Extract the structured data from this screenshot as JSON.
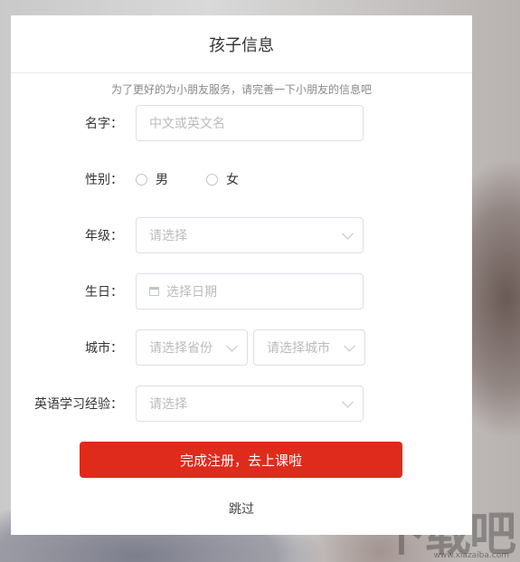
{
  "modal": {
    "title": "孩子信息",
    "hint": "为了更好的为小朋友服务，请完善一下小朋友的信息吧"
  },
  "form": {
    "name": {
      "label": "名字：",
      "placeholder": "中文或英文名"
    },
    "gender": {
      "label": "性别：",
      "options": [
        "男",
        "女"
      ]
    },
    "grade": {
      "label": "年级：",
      "placeholder": "请选择"
    },
    "birthday": {
      "label": "生日：",
      "placeholder": "选择日期"
    },
    "city": {
      "label": "城市：",
      "province_placeholder": "请选择省份",
      "city_placeholder": "请选择城市"
    },
    "english_experience": {
      "label": "英语学习经验：",
      "placeholder": "请选择"
    }
  },
  "actions": {
    "submit_label": "完成注册，去上课啦",
    "skip_label": "跳过"
  },
  "watermark": {
    "brand": "下载吧",
    "url": "www.xiazaiba.com"
  },
  "colors": {
    "primary": "#de2b1c",
    "border": "#dcdfe6",
    "placeholder": "#bbbbbb"
  }
}
